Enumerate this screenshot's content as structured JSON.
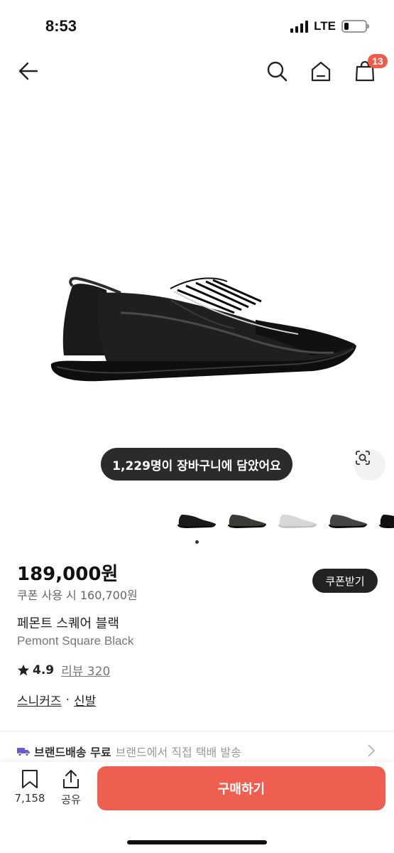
{
  "status_bar": {
    "time": "8:53",
    "network": "LTE",
    "battery_level": 0.2
  },
  "header": {
    "back_icon": "arrow-left-icon",
    "search_icon": "search-icon",
    "home_icon": "home-icon",
    "cart_icon": "shopping-bag-icon",
    "cart_count": "13"
  },
  "hero": {
    "cart_toast": "1,229명이 장바구니에 담았어요",
    "lens_icon": "image-search-icon",
    "thumb_colors": [
      "#1a1a1a",
      "#3a3a36",
      "#d7d7d7",
      "#444444",
      "#111111"
    ]
  },
  "product": {
    "price": "189,000원",
    "coupon_price": "쿠폰 사용 시 160,700원",
    "coupon_button": "쿠폰받기",
    "name_ko": "페몬트 스퀘어 블랙",
    "name_en": "Pemont Square Black",
    "rating": "4.9",
    "review_label": "리뷰 320",
    "category_1": "스니커즈",
    "category_sep": "·",
    "category_2": "신발"
  },
  "shipping": {
    "strong": "브랜드배송 무료",
    "light": "브랜드에서 직접 택배 발송",
    "icon": "truck-icon"
  },
  "bottom_bar": {
    "bookmark_count": "7,158",
    "share_label": "공유",
    "buy_label": "구매하기"
  },
  "colors": {
    "accent": "#ef5f51",
    "badge": "#ef5b4c",
    "truck": "#6a5acd"
  }
}
